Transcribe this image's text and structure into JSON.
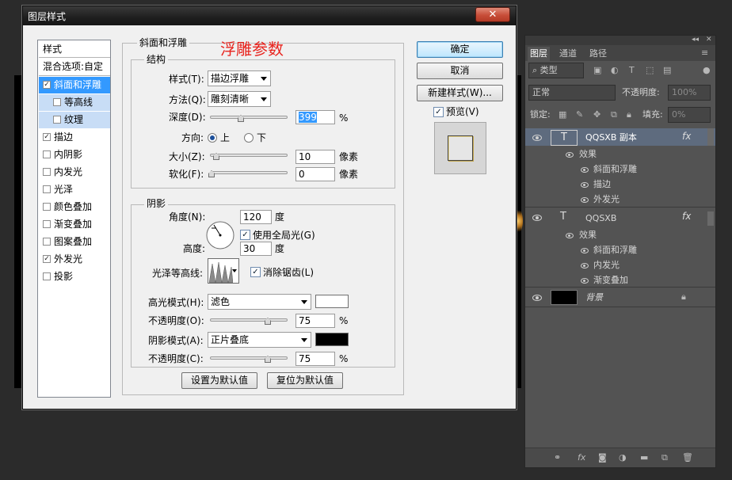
{
  "dialog": {
    "title": "图层样式",
    "close_symbol": "✕",
    "annotation": "浮雕参数"
  },
  "style_list": {
    "header": "样式",
    "blend": "混合选项:自定",
    "items": [
      {
        "label": "斜面和浮雕",
        "checked": true,
        "state": "selected"
      },
      {
        "label": "等高线",
        "checked": false,
        "state": "sub"
      },
      {
        "label": "纹理",
        "checked": false,
        "state": "sub"
      },
      {
        "label": "描边",
        "checked": true
      },
      {
        "label": "内阴影",
        "checked": false
      },
      {
        "label": "内发光",
        "checked": false
      },
      {
        "label": "光泽",
        "checked": false
      },
      {
        "label": "颜色叠加",
        "checked": false
      },
      {
        "label": "渐变叠加",
        "checked": false
      },
      {
        "label": "图案叠加",
        "checked": false
      },
      {
        "label": "外发光",
        "checked": true
      },
      {
        "label": "投影",
        "checked": false
      }
    ]
  },
  "bevel": {
    "group_title": "斜面和浮雕",
    "structure_title": "结构",
    "style_label": "样式(T):",
    "style_value": "描边浮雕",
    "technique_label": "方法(Q):",
    "technique_value": "雕刻清晰",
    "depth_label": "深度(D):",
    "depth_value": "399",
    "depth_unit": "%",
    "depth_level": 0.4,
    "direction_label": "方向:",
    "direction_up": "上",
    "direction_down": "下",
    "size_label": "大小(Z):",
    "size_value": "10",
    "size_unit": "像素",
    "soften_label": "软化(F):",
    "soften_value": "0",
    "soften_unit": "像素"
  },
  "shading": {
    "title": "阴影",
    "angle_label": "角度(N):",
    "angle_value": "120",
    "angle_unit": "度",
    "global_light_label": "使用全局光(G)",
    "altitude_label": "高度:",
    "altitude_value": "30",
    "altitude_unit": "度",
    "gloss_label": "光泽等高线:",
    "antialias_label": "消除锯齿(L)",
    "highlight_mode_label": "高光模式(H):",
    "highlight_mode_value": "滤色",
    "highlight_color": "#ffffff",
    "highlight_opacity_label": "不透明度(O):",
    "highlight_opacity_value": "75",
    "shadow_mode_label": "阴影模式(A):",
    "shadow_mode_value": "正片叠底",
    "shadow_color": "#000000",
    "shadow_opacity_label": "不透明度(C):",
    "shadow_opacity_value": "75",
    "percent": "%"
  },
  "footer_buttons": {
    "make_default": "设置为默认值",
    "reset_default": "复位为默认值"
  },
  "right_buttons": {
    "ok": "确定",
    "cancel": "取消",
    "new_style": "新建样式(W)...",
    "preview_label": "预览(V)"
  },
  "layers_panel": {
    "tabs": [
      "图层",
      "通道",
      "路径"
    ],
    "collapse": "◂◂",
    "close": "✕",
    "menu": "≡",
    "filter_kind": "类型",
    "blend_mode": "正常",
    "opacity_label": "不透明度:",
    "opacity_value": "100%",
    "lock_label": "锁定:",
    "fill_label": "填充:",
    "fill_value": "0%",
    "layers": [
      {
        "name": "QQSXB 副本",
        "effects_label": "效果",
        "effects": [
          "斜面和浮雕",
          "描边",
          "外发光"
        ]
      },
      {
        "name": "QQSXB",
        "effects_label": "效果",
        "effects": [
          "斜面和浮雕",
          "内发光",
          "渐变叠加"
        ]
      },
      {
        "name": "背景"
      }
    ],
    "fx_symbol": "fx",
    "text_layer_symbol": "T"
  },
  "colors": {
    "selected_row": "#3399ff",
    "annotation": "#e8241e",
    "panel_bg": "#535353"
  }
}
